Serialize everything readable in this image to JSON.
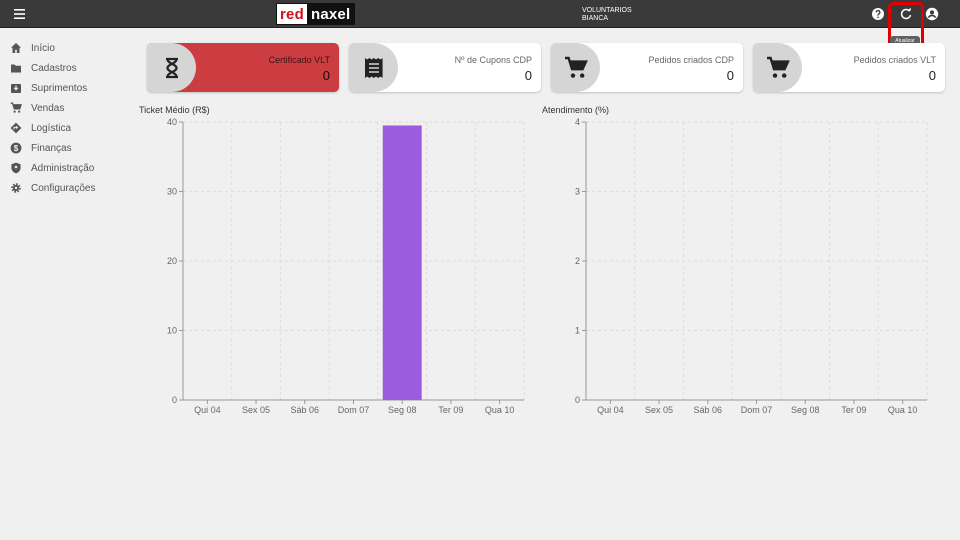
{
  "topbar": {
    "logo_part1": "red",
    "logo_part2": "naxel",
    "user_line1": "VOLUNTARIOS",
    "user_line2": "BIANCA",
    "tooltip": "Atualizar",
    "icons": [
      "menu-icon",
      "help-icon",
      "refresh-icon",
      "account-icon"
    ]
  },
  "sidebar": {
    "items": [
      {
        "label": "Início",
        "icon": "home-icon"
      },
      {
        "label": "Cadastros",
        "icon": "folder-icon"
      },
      {
        "label": "Suprimentos",
        "icon": "inbox-icon"
      },
      {
        "label": "Vendas",
        "icon": "cart-icon"
      },
      {
        "label": "Logística",
        "icon": "directions-icon"
      },
      {
        "label": "Finanças",
        "icon": "dollar-icon"
      },
      {
        "label": "Administração",
        "icon": "shield-icon"
      },
      {
        "label": "Configurações",
        "icon": "gear-icon"
      }
    ]
  },
  "cards": [
    {
      "title": "Certificado VLT",
      "value": "0",
      "icon": "hourglass-icon",
      "color": "#cc3d41"
    },
    {
      "title": "Nº de Cupons CDP",
      "value": "0",
      "icon": "receipt-icon",
      "color": "#ffffff"
    },
    {
      "title": "Pedidos criados CDP",
      "value": "0",
      "icon": "cart-icon",
      "color": "#ffffff"
    },
    {
      "title": "Pedidos criados VLT",
      "value": "0",
      "icon": "cart-icon",
      "color": "#ffffff"
    }
  ],
  "chart_data": [
    {
      "type": "bar",
      "title": "Ticket Médio (R$)",
      "categories": [
        "Qui 04",
        "Sex 05",
        "Sáb 06",
        "Dom 07",
        "Seg 08",
        "Ter 09",
        "Qua 10"
      ],
      "values": [
        0,
        0,
        0,
        0,
        39.5,
        0,
        0
      ],
      "ylim": [
        0,
        40
      ],
      "yticks": [
        0,
        10,
        20,
        30,
        40
      ],
      "bar_color": "#9c5ce0",
      "grid": true
    },
    {
      "type": "bar",
      "title": "Atendimento (%)",
      "categories": [
        "Qui 04",
        "Sex 05",
        "Sáb 06",
        "Dom 07",
        "Seg 08",
        "Ter 09",
        "Qua 10"
      ],
      "values": [
        0,
        0,
        0,
        0,
        0,
        0,
        0
      ],
      "ylim": [
        0,
        4
      ],
      "yticks": [
        0,
        1,
        2,
        3,
        4
      ],
      "bar_color": "#9c5ce0",
      "grid": true
    }
  ]
}
